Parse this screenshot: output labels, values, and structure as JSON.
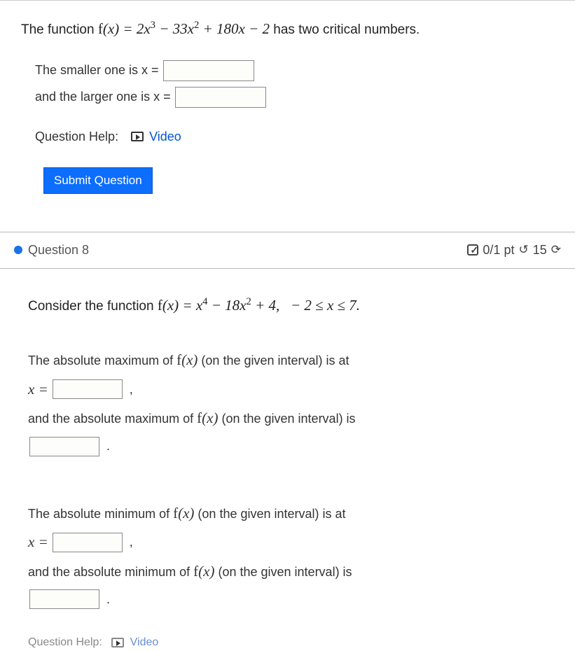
{
  "q7": {
    "function_intro": "The function ",
    "function_math": "f(x) = 2x³ − 33x² + 180x − 2",
    "function_outro": " has two critical numbers.",
    "smaller_label": "The smaller one is x = ",
    "larger_label": "and the larger one is x = ",
    "help_label": "Question Help:",
    "video_label": "Video",
    "submit_label": "Submit Question"
  },
  "q8": {
    "header_title": "Question 8",
    "points": "0/1 pt",
    "attempts": "15",
    "consider_intro": "Consider the function ",
    "consider_math": "f(x) = x⁴ − 18x² + 4,    − 2 ≤ x ≤ 7.",
    "abs_max_at": "The absolute maximum of ",
    "fx": "f(x)",
    "on_interval_at": " (on the given interval) is at",
    "x_equals": "x = ",
    "abs_max_is_pre": "and the absolute maximum of ",
    "on_interval_is": " (on the given interval) is",
    "abs_min_at": "The absolute minimum of ",
    "abs_min_is_pre": "and the absolute minimum of ",
    "bottom_help": "Question Help:",
    "bottom_video": "Video"
  }
}
